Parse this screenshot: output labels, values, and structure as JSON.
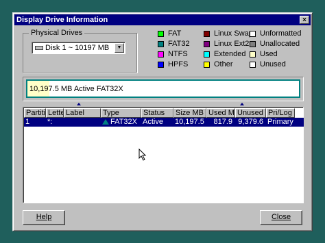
{
  "window": {
    "title": "Display Drive Information",
    "close_glyph": "×"
  },
  "physical_drives": {
    "label": "Physical Drives",
    "selected": "Disk 1 ~ 10197  MB"
  },
  "legend": [
    {
      "label": "FAT",
      "color": "#00ff00"
    },
    {
      "label": "FAT32",
      "color": "#008080"
    },
    {
      "label": "NTFS",
      "color": "#ff00ff"
    },
    {
      "label": "HPFS",
      "color": "#0000ff"
    },
    {
      "label": "Linux Swap",
      "color": "#800000"
    },
    {
      "label": "Linux Ext2",
      "color": "#800080"
    },
    {
      "label": "Extended",
      "color": "#00ffff"
    },
    {
      "label": "Other",
      "color": "#ffff00"
    },
    {
      "label": "Unformatted",
      "color": "#ffffff"
    },
    {
      "label": "Unallocated",
      "color": "#808080"
    },
    {
      "label": "Used",
      "color": "#ffffc8"
    },
    {
      "label": "Unused",
      "color": "#ffffff"
    }
  ],
  "partition_bar": {
    "text": "10,197.5 MB Active FAT32X",
    "used_fraction": 0.08
  },
  "table": {
    "headers": [
      "Partition",
      "Letter",
      "Label",
      "Type",
      "Status",
      "Size MB",
      "Used MB",
      "Unused MB",
      "Pri/Log"
    ],
    "rows": [
      {
        "partition": "1",
        "letter": "*:",
        "label": "",
        "type": "FAT32X",
        "status": "Active",
        "size": "10,197.5",
        "used": "817.9",
        "unused": "9,379.6",
        "prilog": "Primary"
      }
    ]
  },
  "buttons": {
    "help": "Help",
    "close": "Close"
  }
}
